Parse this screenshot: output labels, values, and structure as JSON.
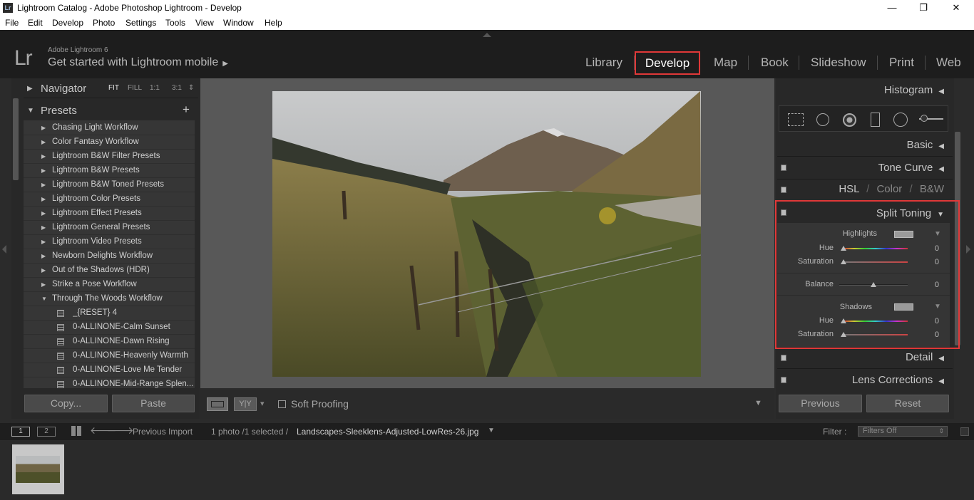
{
  "window": {
    "title": "Lightroom Catalog - Adobe Photoshop Lightroom - Develop",
    "app_icon_text": "Lr",
    "minimize": "—",
    "restore": "❐",
    "close": "✕"
  },
  "menu": [
    "File",
    "Edit",
    "Develop",
    "Photo",
    "Settings",
    "Tools",
    "View",
    "Window",
    "Help"
  ],
  "identity": {
    "logo": "Lr",
    "version": "Adobe Lightroom 6",
    "mobile": "Get started with Lightroom mobile",
    "mobile_arrow": "▶"
  },
  "modules": {
    "library": "Library",
    "develop": "Develop",
    "map": "Map",
    "book": "Book",
    "slideshow": "Slideshow",
    "print": "Print",
    "web": "Web"
  },
  "navigator": {
    "title": "Navigator",
    "fit": "FIT",
    "fill": "FILL",
    "one": "1:1",
    "three": "3:1",
    "menu": "⇕"
  },
  "presets": {
    "title": "Presets",
    "add": "+",
    "folders": [
      "Chasing Light Workflow",
      "Color Fantasy Workflow",
      "Lightroom B&W Filter Presets",
      "Lightroom B&W Presets",
      "Lightroom B&W Toned Presets",
      "Lightroom Color Presets",
      "Lightroom Effect Presets",
      "Lightroom General Presets",
      "Lightroom Video Presets",
      "Newborn Delights Workflow",
      "Out of the Shadows (HDR)",
      "Strike a Pose Workflow"
    ],
    "open_folder": "Through The Woods Workflow",
    "items": [
      "_{RESET} 4",
      "0-ALLINONE-Calm Sunset",
      "0-ALLINONE-Dawn Rising",
      "0-ALLINONE-Heavenly Warmth",
      "0-ALLINONE-Love Me Tender",
      "0-ALLINONE-Mid-Range Splen..."
    ]
  },
  "left_buttons": {
    "copy": "Copy...",
    "paste": "Paste"
  },
  "toolbar": {
    "soft_proofing": "Soft Proofing",
    "yy": "Y|Y",
    "dropdown": "▾",
    "expand": "▼"
  },
  "right_panel": {
    "histogram": "Histogram",
    "basic": "Basic",
    "tone_curve": "Tone Curve",
    "hsl": "HSL",
    "color": "Color",
    "bw": "B&W",
    "slash": "/",
    "split_toning": "Split Toning",
    "highlights": "Highlights",
    "shadows": "Shadows",
    "hue": "Hue",
    "saturation": "Saturation",
    "balance": "Balance",
    "values": {
      "hl_hue": "0",
      "hl_sat": "0",
      "balance": "0",
      "sh_hue": "0",
      "sh_sat": "0"
    },
    "detail": "Detail",
    "lens_corrections": "Lens Corrections",
    "collapse_left": "◀",
    "expanded": "▼"
  },
  "right_buttons": {
    "previous": "Previous",
    "reset": "Reset"
  },
  "filmstrip": {
    "screen1": "1",
    "screen2": "2",
    "source": "Previous Import",
    "count": "1 photo /1 selected /",
    "filename": "Landscapes-Sleeklens-Adjusted-LowRes-26.jpg",
    "filter_label": "Filter :",
    "filter_value": "Filters Off"
  },
  "slider_positions": {
    "hl_hue": 0,
    "hl_sat": 0,
    "balance": 0,
    "sh_hue": 0,
    "sh_sat": 0
  },
  "colors": {
    "highlight_box": "#e03838",
    "panel_bg": "#282828",
    "top_bg": "#1d1d1d"
  }
}
